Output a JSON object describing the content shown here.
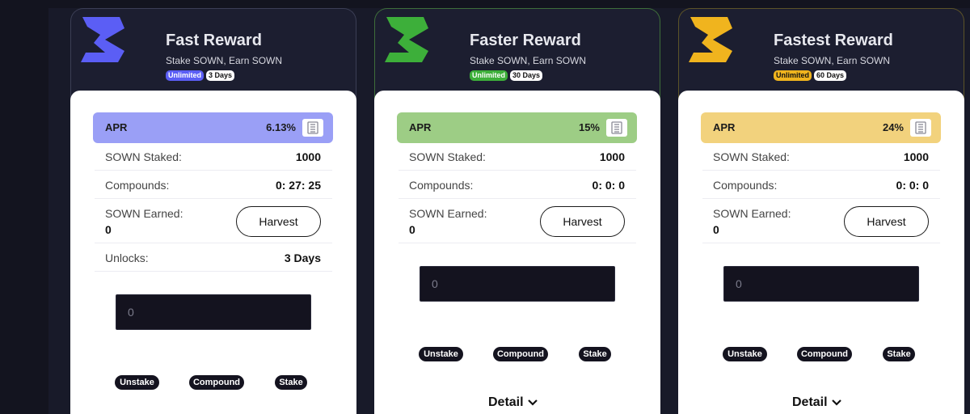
{
  "sidebar": {
    "items": [
      {
        "icon": "swap-arrows-icon"
      },
      {
        "icon": "percent-icon"
      },
      {
        "icon": "dollar-icon"
      },
      {
        "icon": "layers-icon"
      },
      {
        "icon": "image-icon"
      },
      {
        "icon": "shopping-bag-icon"
      },
      {
        "icon": "document-icon"
      },
      {
        "icon": "lock-icon"
      },
      {
        "icon": "user-icon"
      },
      {
        "icon": "twitter-icon"
      },
      {
        "icon": "send-icon"
      }
    ]
  },
  "pools": [
    {
      "title": "Fast Reward",
      "subtitle": "Stake SOWN, Earn SOWN",
      "badge_type": "Unlimited",
      "badge_duration": "3 Days",
      "accent": "#5b5ef5",
      "apr_bg": "#9a9ff6",
      "apr_label": "APR",
      "apr_value": "6.13%",
      "staked_label": "SOWN Staked:",
      "staked_value": "1000",
      "compounds_label": "Compounds:",
      "compounds_value": "0: 27: 25",
      "earned_label": "SOWN Earned:",
      "earned_value": "0",
      "harvest_label": "Harvest",
      "unlocks_label": "Unlocks:",
      "unlocks_value": "3 Days",
      "input_placeholder": "0",
      "unstake_label": "Unstake",
      "compound_label": "Compound",
      "stake_label": "Stake"
    },
    {
      "title": "Faster Reward",
      "subtitle": "Stake SOWN, Earn SOWN",
      "badge_type": "Unlimited",
      "badge_duration": "30 Days",
      "accent": "#3daf3a",
      "apr_bg": "#9dcd85",
      "apr_label": "APR",
      "apr_value": "15%",
      "staked_label": "SOWN Staked:",
      "staked_value": "1000",
      "compounds_label": "Compounds:",
      "compounds_value": "0: 0: 0",
      "earned_label": "SOWN Earned:",
      "earned_value": "0",
      "harvest_label": "Harvest",
      "input_placeholder": "0",
      "unstake_label": "Unstake",
      "compound_label": "Compound",
      "stake_label": "Stake",
      "detail_label": "Detail"
    },
    {
      "title": "Fastest Reward",
      "subtitle": "Stake SOWN, Earn SOWN",
      "badge_type": "Unlimited",
      "badge_duration": "60 Days",
      "accent": "#f0b41e",
      "apr_bg": "#f2d27d",
      "apr_label": "APR",
      "apr_value": "24%",
      "staked_label": "SOWN Staked:",
      "staked_value": "1000",
      "compounds_label": "Compounds:",
      "compounds_value": "0: 0: 0",
      "earned_label": "SOWN Earned:",
      "earned_value": "0",
      "harvest_label": "Harvest",
      "input_placeholder": "0",
      "unstake_label": "Unstake",
      "compound_label": "Compound",
      "stake_label": "Stake",
      "detail_label": "Detail"
    }
  ]
}
